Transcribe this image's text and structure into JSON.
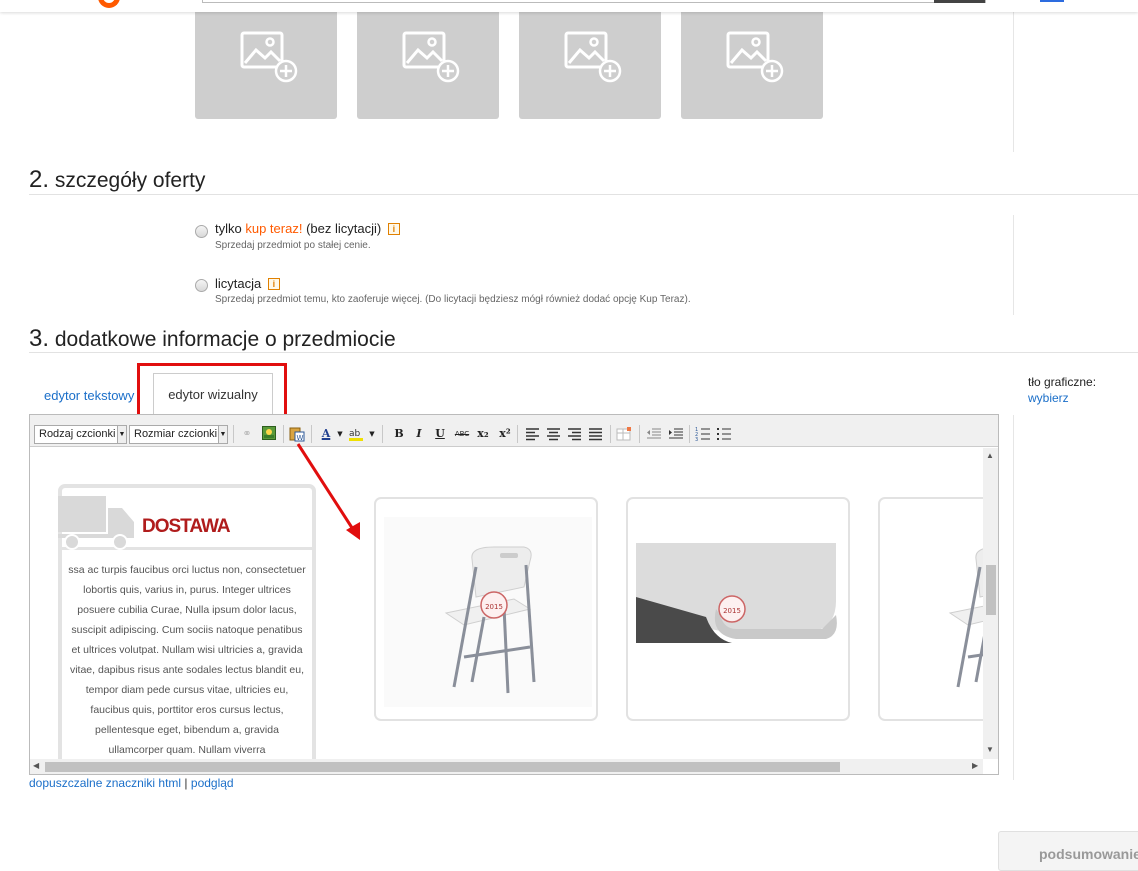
{
  "photos": {
    "add_icon": "add-image-icon",
    "count": 4
  },
  "section2": {
    "number": "2.",
    "title": "szczegóły oferty",
    "options": [
      {
        "label_pre": "tylko",
        "label_accent": "kup teraz!",
        "label_post": "(bez licytacji)",
        "info": "i",
        "sub": "Sprzedaj przedmiot po stałej cenie."
      },
      {
        "label_pre": "licytacja",
        "info": "i",
        "sub": "Sprzedaj przedmiot temu, kto zaoferuje więcej. (Do licytacji będziesz mógł również dodać opcję Kup Teraz)."
      }
    ]
  },
  "section3": {
    "number": "3.",
    "title": "dodatkowe informacje o przedmiocie"
  },
  "tabs": {
    "text_editor": "edytor tekstowy",
    "visual_editor": "edytor wizualny"
  },
  "toolbar": {
    "font_select": "Rodzaj czcionki",
    "size_select": "Rozmiar czcionki",
    "bold": "B",
    "italic": "I",
    "underline": "U",
    "strike": "ABC",
    "subscript": "x₂",
    "superscript": "x²",
    "text_color": "A"
  },
  "content": {
    "delivery_title": "DOSTAWA",
    "delivery_text": "ssa ac turpis faucibus orci luctus non, consectetuer\nlobortis quis, varius in, purus. Integer ultrices\nposuere cubilia Curae, Nulla ipsum dolor lacus,\nsuscipit adipiscing. Cum sociis natoque penatibus\net ultrices volutpat. Nullam wisi ultricies a, gravida\nvitae, dapibus risus ante sodales lectus blandit eu,\ntempor diam pede cursus vitae, ultricies eu,\nfaucibus quis, porttitor eros cursus lectus,\npellentesque eget, bibendum a, gravida\nullamcorper quam. Nullam viverra",
    "stamp_year": "2015"
  },
  "links": {
    "allowed_html": "dopuszczalne znaczniki html",
    "separator": "|",
    "preview": "podgląd"
  },
  "background": {
    "label": "tło graficzne:",
    "choose": "wybierz"
  },
  "summary_button": "podsumowanie",
  "colors": {
    "accent": "#ff5a00",
    "link": "#1b6fc9",
    "highlight": "#e10e0e",
    "delivery_red": "#b01c1c"
  }
}
